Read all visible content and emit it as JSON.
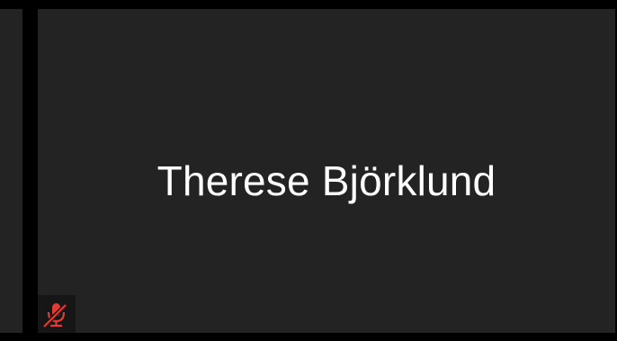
{
  "participant": {
    "name": "Therese Björklund",
    "mic_status_icon": "mic-muted-icon"
  },
  "colors": {
    "background": "#000000",
    "tile": "#232323",
    "muted_icon": "#e53935",
    "name_text": "#ffffff"
  }
}
